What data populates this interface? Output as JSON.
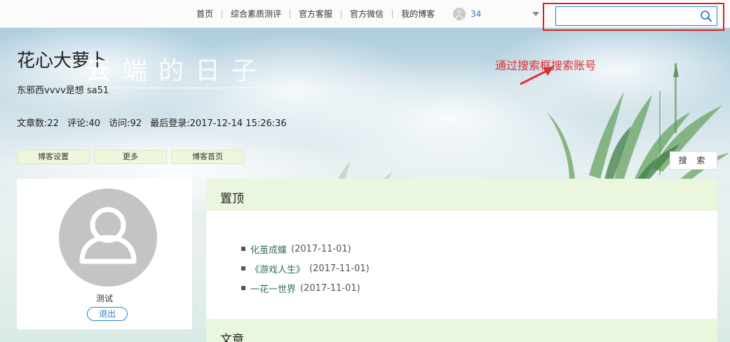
{
  "nav": {
    "links": [
      "首页",
      "综合素质测评",
      "官方客服",
      "官方微信",
      "我的博客"
    ],
    "user_count": "34"
  },
  "search": {
    "value": "",
    "placeholder": ""
  },
  "annotation": "通过搜索框搜索账号",
  "blog": {
    "title": "花心大萝卜",
    "art_title": "云端的日子",
    "subtitle": "东邪西vvvv是想 sa51",
    "stats": {
      "articles": "文章数:22",
      "comments": "评论:40",
      "visits": "访问:92",
      "last_login": "最后登录:2017-12-14 15:26:36"
    }
  },
  "tabs": [
    "博客设置",
    "更多",
    "博客首页"
  ],
  "search_button": "搜 索",
  "profile": {
    "name": "测试",
    "logout": "退出"
  },
  "pinned": {
    "title": "置顶",
    "posts": [
      {
        "title": "化茧成蝶",
        "date": "(2017-11-01)"
      },
      {
        "title": "《游戏人生》",
        "date": "(2017-11-01)"
      },
      {
        "title": "一花一世界",
        "date": "(2017-11-01)"
      }
    ]
  },
  "articles": {
    "title": "文章"
  },
  "colors": {
    "accent": "#2d7fd0",
    "highlight": "#e02020",
    "panel_header": "#eaf6dd"
  }
}
